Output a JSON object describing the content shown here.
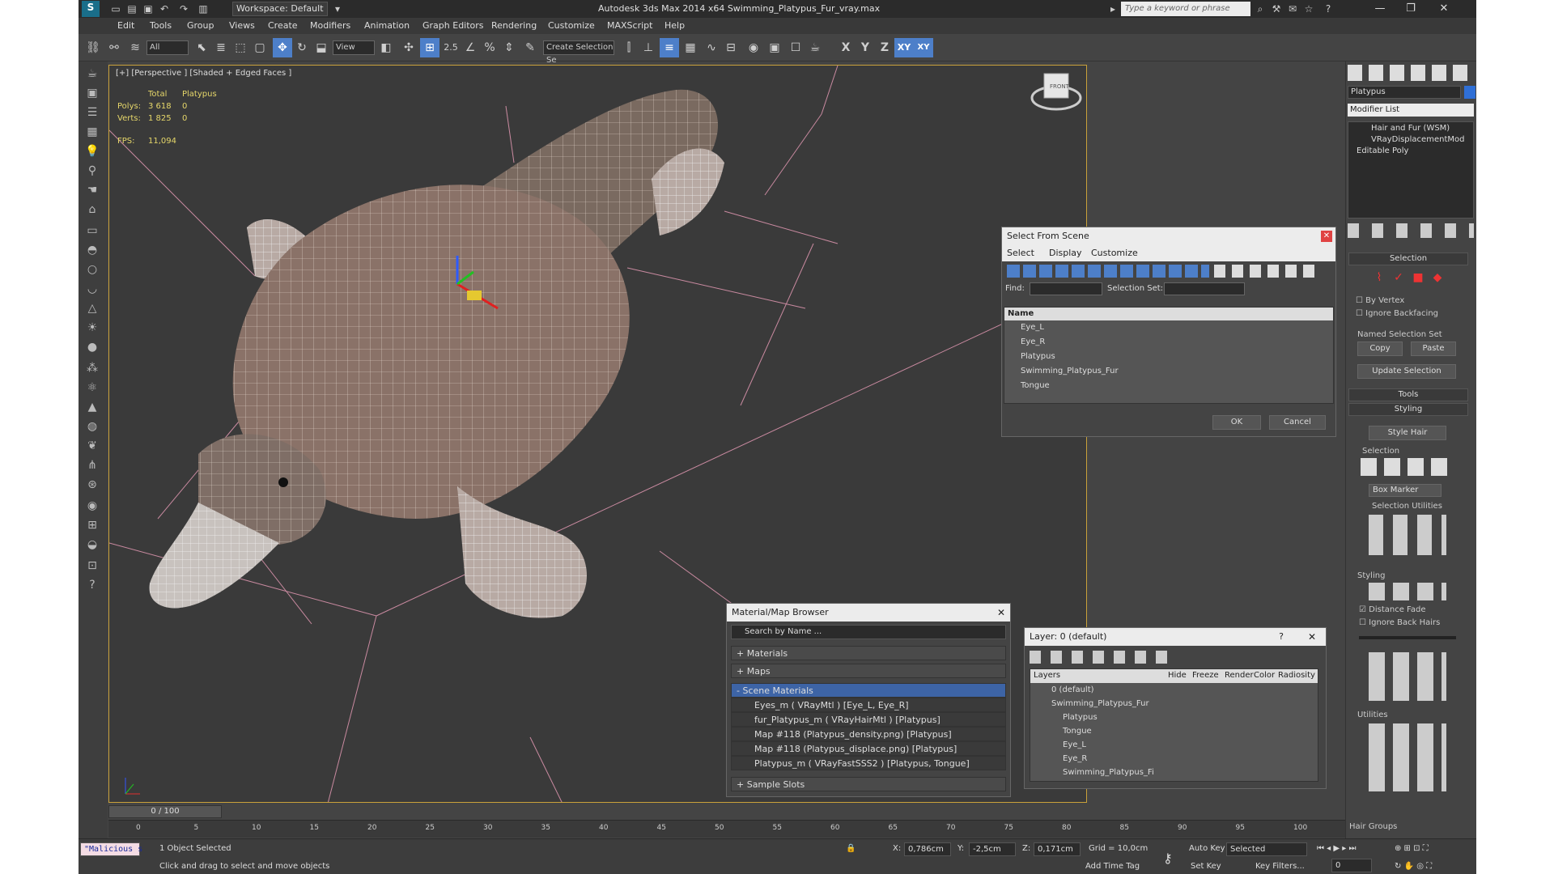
{
  "titlebar": {
    "workspace": "Workspace: Default",
    "title": "Autodesk 3ds Max  2014 x64     Swimming_Platypus_Fur_vray.max",
    "search_placeholder": "Type a keyword or phrase"
  },
  "menu": [
    "Edit",
    "Tools",
    "Group",
    "Views",
    "Create",
    "Modifiers",
    "Animation",
    "Graph Editors",
    "Rendering",
    "Customize",
    "MAXScript",
    "Help"
  ],
  "toolbar": {
    "filter": "All",
    "refcoord": "View",
    "snap_label": "2.5",
    "named_sel": "Create Selection Se",
    "axis_x": "X",
    "axis_y": "Y",
    "axis_z": "Z",
    "axis_xy": "XY",
    "axis_xy2": "XY"
  },
  "viewport": {
    "label": "[+] [Perspective ] [Shaded + Edged Faces ]",
    "stats": {
      "total": "Total",
      "obj": "Platypus",
      "polys_label": "Polys:",
      "polys_total": "3 618",
      "polys_obj": "0",
      "verts_label": "Verts:",
      "verts_total": "1 825",
      "verts_obj": "0",
      "fps_label": "FPS:",
      "fps_value": "11,094"
    },
    "viewcube": "FRONT"
  },
  "select_from_scene": {
    "title": "Select From Scene",
    "menu": [
      "Select",
      "Display",
      "Customize"
    ],
    "find_label": "Find:",
    "selset_label": "Selection Set:",
    "col_name": "Name",
    "items": [
      "Eye_L",
      "Eye_R",
      "Platypus",
      "Swimming_Platypus_Fur",
      "Tongue"
    ],
    "ok": "OK",
    "cancel": "Cancel"
  },
  "material_browser": {
    "title": "Material/Map Browser",
    "search": "Search by Name ...",
    "sections": [
      "+ Materials",
      "+ Maps",
      "- Scene Materials"
    ],
    "items": [
      "Eyes_m  ( VRayMtl ) [Eye_L, Eye_R]",
      "fur_Platypus_m  ( VRayHairMtl ) [Platypus]",
      "Map #118 (Platypus_density.png) [Platypus]",
      "Map #118 (Platypus_displace.png) [Platypus]",
      "Platypus_m  ( VRayFastSSS2 ) [Platypus, Tongue]"
    ],
    "sample_slots": "+ Sample Slots"
  },
  "layer_dialog": {
    "title": "Layer: 0 (default)",
    "help": "?",
    "headers": [
      "Layers",
      "Hide",
      "Freeze",
      "Render",
      "Color",
      "Radiosity"
    ],
    "rows": [
      "0 (default)",
      "Swimming_Platypus_Fur",
      "Platypus",
      "Tongue",
      "Eye_L",
      "Eye_R",
      "Swimming_Platypus_Fi"
    ]
  },
  "command_panel": {
    "object_name": "Platypus",
    "modifier_list": "Modifier List",
    "stack": [
      "Hair and Fur (WSM)",
      "VRayDisplacementMod",
      "Editable Poly"
    ],
    "selection_title": "Selection",
    "by_vertex": "By Vertex",
    "ignore_backfacing": "Ignore Backfacing",
    "named_sel_sets": "Named Selection Set",
    "copy": "Copy",
    "paste": "Paste",
    "update_selection": "Update Selection",
    "tools": "Tools",
    "styling": "Styling",
    "style_hair": "Style Hair",
    "sel2": "Selection",
    "box_marker": "Box Marker",
    "sel_utils": "Selection Utilities",
    "styling2": "Styling",
    "distance_fade": "Distance Fade",
    "ignore_back_hairs": "Ignore Back Hairs",
    "utilities": "Utilities",
    "hair_groups": "Hair Groups"
  },
  "timeline": {
    "frame": "0 / 100",
    "ticks": [
      "0",
      "5",
      "10",
      "15",
      "20",
      "25",
      "30",
      "35",
      "40",
      "45",
      "50",
      "55",
      "60",
      "65",
      "70",
      "75",
      "80",
      "85",
      "90",
      "95",
      "100"
    ]
  },
  "status": {
    "maxscript": "\"Malicious s",
    "selected": "1 Object Selected",
    "prompt": "Click and drag to select and move objects",
    "x_label": "X:",
    "x": "0,786cm",
    "y_label": "Y:",
    "y": "-2,5cm",
    "z_label": "Z:",
    "z": "0,171cm",
    "grid": "Grid = 10,0cm",
    "add_time_tag": "Add Time Tag",
    "auto_key": "Auto Key",
    "selected_dd": "Selected",
    "set_key": "Set Key",
    "key_filters": "Key Filters...",
    "frame_field": "0"
  }
}
